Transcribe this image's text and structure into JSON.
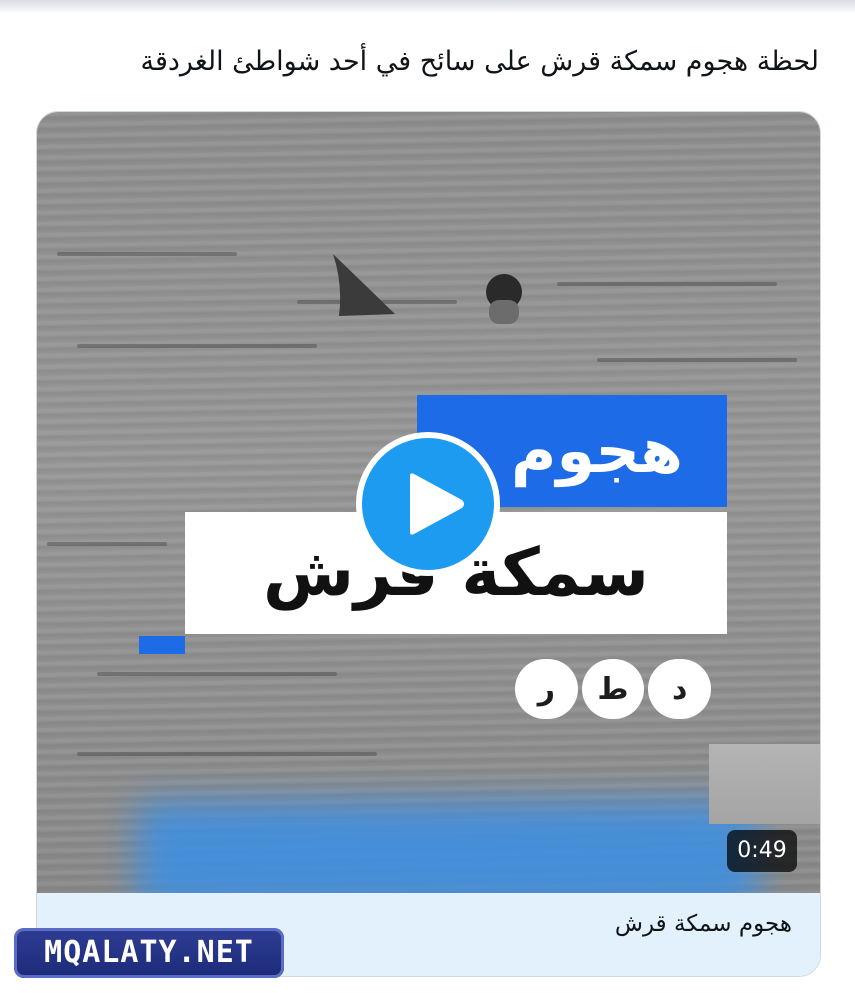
{
  "tweet": {
    "text": "لحظة هجوم سمكة قرش على سائح في أحد شواطئ الغردقة"
  },
  "video": {
    "headline_line1": "هجوم",
    "headline_line2": "سمكة قرش",
    "logo_letters": [
      "ر",
      "ط",
      "د"
    ],
    "duration": "0:49",
    "play_icon": "play-icon"
  },
  "card": {
    "title": "هجوم سمكة قرش"
  },
  "watermark": {
    "text": "MQALATY.NET"
  },
  "colors": {
    "play_button": "#1d9bf0",
    "banner_blue": "#1d6be6",
    "footer_bg": "#e3f1fc"
  }
}
